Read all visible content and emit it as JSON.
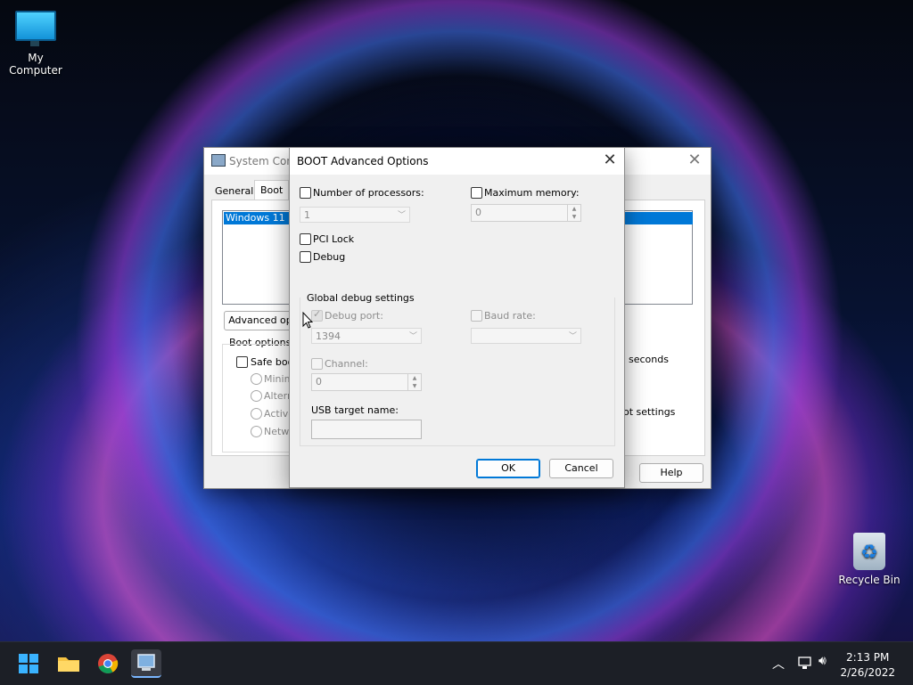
{
  "desktop": {
    "icons": [
      {
        "label": "My Computer"
      },
      {
        "label": "Recycle Bin"
      }
    ]
  },
  "sysconfig": {
    "title": "System Conf",
    "tabs": [
      "General",
      "Boot"
    ],
    "list_item": "Windows 11 (C",
    "advanced_button": "Advanced op",
    "boot_options_label": "Boot options",
    "safe_boot": "Safe boo",
    "radios": [
      "Minima",
      "Altern",
      "Active",
      "Netwo"
    ],
    "seconds": "seconds",
    "boot_settings": "ot settings",
    "help_button": "Help"
  },
  "advanced": {
    "title": "BOOT Advanced Options",
    "num_processors": {
      "label": "Number of processors:",
      "value": "1"
    },
    "max_memory": {
      "label": "Maximum memory:",
      "value": "0"
    },
    "pci_lock": "PCI Lock",
    "debug": "Debug",
    "global_debug": {
      "label": "Global debug settings",
      "debug_port": {
        "label": "Debug port:",
        "value": "1394"
      },
      "baud_rate": {
        "label": "Baud rate:",
        "value": ""
      },
      "channel": {
        "label": "Channel:",
        "value": "0"
      },
      "usb_target": {
        "label": "USB target name:",
        "value": ""
      }
    },
    "ok": "OK",
    "cancel": "Cancel"
  },
  "taskbar": {
    "time": "2:13 PM",
    "date": "2/26/2022"
  }
}
